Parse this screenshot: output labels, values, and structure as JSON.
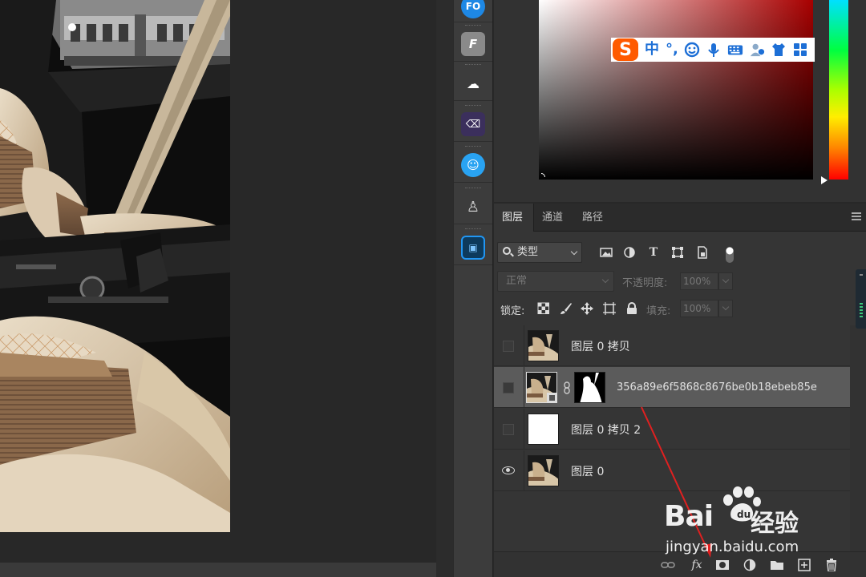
{
  "app": "Photoshop",
  "ime_toolbar": {
    "logo": "S",
    "mode": "中",
    "punct": "°,",
    "icons": [
      "emoji-icon",
      "mic-icon",
      "keyboard-icon",
      "user-icon",
      "skin-icon",
      "grid-icon"
    ]
  },
  "tools": [
    "fo-icon",
    "font-icon",
    "weather-icon",
    "eraser-icon",
    "face-icon",
    "person-icon",
    "image-icon"
  ],
  "colors": {
    "accent": "#1d6fd6",
    "ime_logo": "#ff5a00",
    "panel_bg": "#353535",
    "selected_row": "#5b5b5b",
    "annotation": "#e02020"
  },
  "layers_panel": {
    "tabs": [
      "图层",
      "通道",
      "路径"
    ],
    "active_tab": "图层",
    "filter_kind": "类型",
    "filter_icons": [
      "image-filter-icon",
      "adjustment-filter-icon",
      "type-filter-icon",
      "shape-filter-icon",
      "smart-object-filter-icon",
      "toggle-filter-icon"
    ],
    "blend_mode": "正常",
    "opacity_label": "不透明度:",
    "opacity_value": "100%",
    "lock_label": "锁定:",
    "fill_label": "填充:",
    "fill_value": "100%",
    "layers": [
      {
        "name": "图层 0 拷贝",
        "visible": false,
        "selected": false,
        "thumb": "photo"
      },
      {
        "name": "356a89e6f5868c8676be0b18ebeb85e",
        "visible": false,
        "selected": true,
        "thumb": "photo",
        "has_mask": true
      },
      {
        "name": "图层 0 拷贝 2",
        "visible": false,
        "selected": false,
        "thumb": "white"
      },
      {
        "name": "图层 0",
        "visible": true,
        "selected": false,
        "thumb": "photo"
      }
    ],
    "bottom_icons": [
      "link-icon",
      "fx-icon",
      "mask-icon",
      "adjustment-icon",
      "folder-icon",
      "new-layer-icon",
      "trash-icon"
    ],
    "fx_label": "fx"
  },
  "watermark": {
    "brand": "Bai",
    "brand2": "du",
    "cn": "经验",
    "url": "jingyan.baidu.com"
  }
}
